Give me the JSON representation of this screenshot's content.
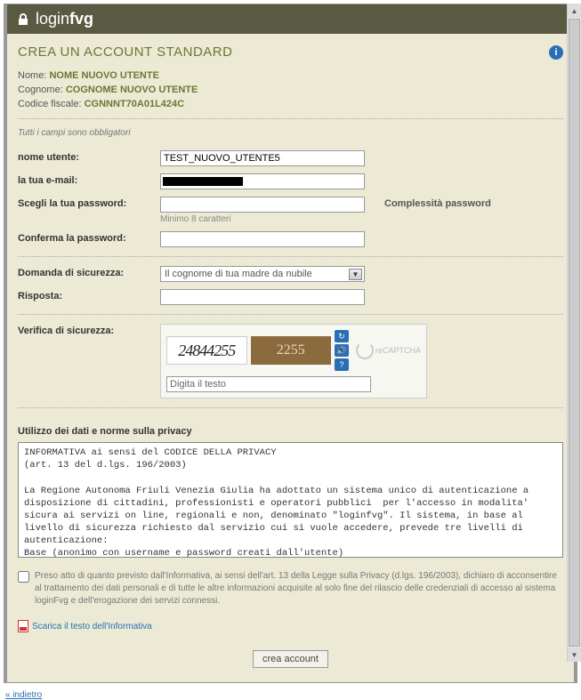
{
  "header": {
    "logo_prefix": "login",
    "logo_suffix": "fvg"
  },
  "page_title": "CREA UN ACCOUNT STANDARD",
  "static": {
    "name_label": "Nome:",
    "name_value": "NOME NUOVO UTENTE",
    "surname_label": "Cognome:",
    "surname_value": "COGNOME NUOVO UTENTE",
    "fiscal_label": "Codice fiscale:",
    "fiscal_value": "CGNNNT70A01L424C"
  },
  "mandatory_note": "Tutti i campi sono obbligatori",
  "fields": {
    "username_label": "nome utente:",
    "username_value": "TEST_NUOVO_UTENTE5",
    "email_label": "la tua e-mail:",
    "password_label": "Scegli la tua password:",
    "password_hint": "Minimo 8 caratteri",
    "password_complexity": "Complessità password",
    "confirm_label": "Conferma la password:",
    "question_label": "Domanda di sicurezza:",
    "question_value": "Il cognome di tua madre da nubile",
    "answer_label": "Risposta:",
    "captcha_label": "Verifica di sicurezza:",
    "captcha_text1": "24844255",
    "captcha_text2": "2255",
    "captcha_placeholder": "Digita il testo",
    "captcha_brand": "reCAPTCHA"
  },
  "privacy": {
    "section_label": "Utilizzo dei dati e norme sulla privacy",
    "text": "INFORMATIVA ai sensi del CODICE DELLA PRIVACY\n(art. 13 del d.lgs. 196/2003)\n\nLa Regione Autonoma Friuli Venezia Giulia ha adottato un sistema unico di autenticazione a disposizione di cittadini, professionisti e operatori pubblici  per l'accesso in modalita' sicura ai servizi on line, regionali e non, denominato \"loginfvg\". Il sistema, in base al livello di sicurezza richiesto dal servizio cui si vuole accedere, prevede tre livelli di autenticazione:\nBase (anonimo con username e password creati dall'utente)\nStandard (riconoscimento dell'identita' con username e password)\nAvanzato (riconoscimento dell'identita' mediante Carta Regionale dei Servizi, altra smart card, Business Key, OTP, CID).\nAi fini dell'utilizzo dell'autenticazione di tipo Base e' necessario completare la procedura di registrazione on line.",
    "consent_text": "Preso atto di quanto previsto dall'Informativa, ai sensi dell'art. 13 della Legge sulla Privacy (d.lgs. 196/2003), dichiaro di acconsentire al trattamento dei dati personali e di tutte le altre informazioni acquisite al solo fine del rilascio delle credenziali di accesso al sistema loginFvg e dell'erogazione dei servizi connessi.",
    "download_label": "Scarica il testo dell'Informativa"
  },
  "buttons": {
    "submit": "crea account",
    "back": "« indietro"
  }
}
